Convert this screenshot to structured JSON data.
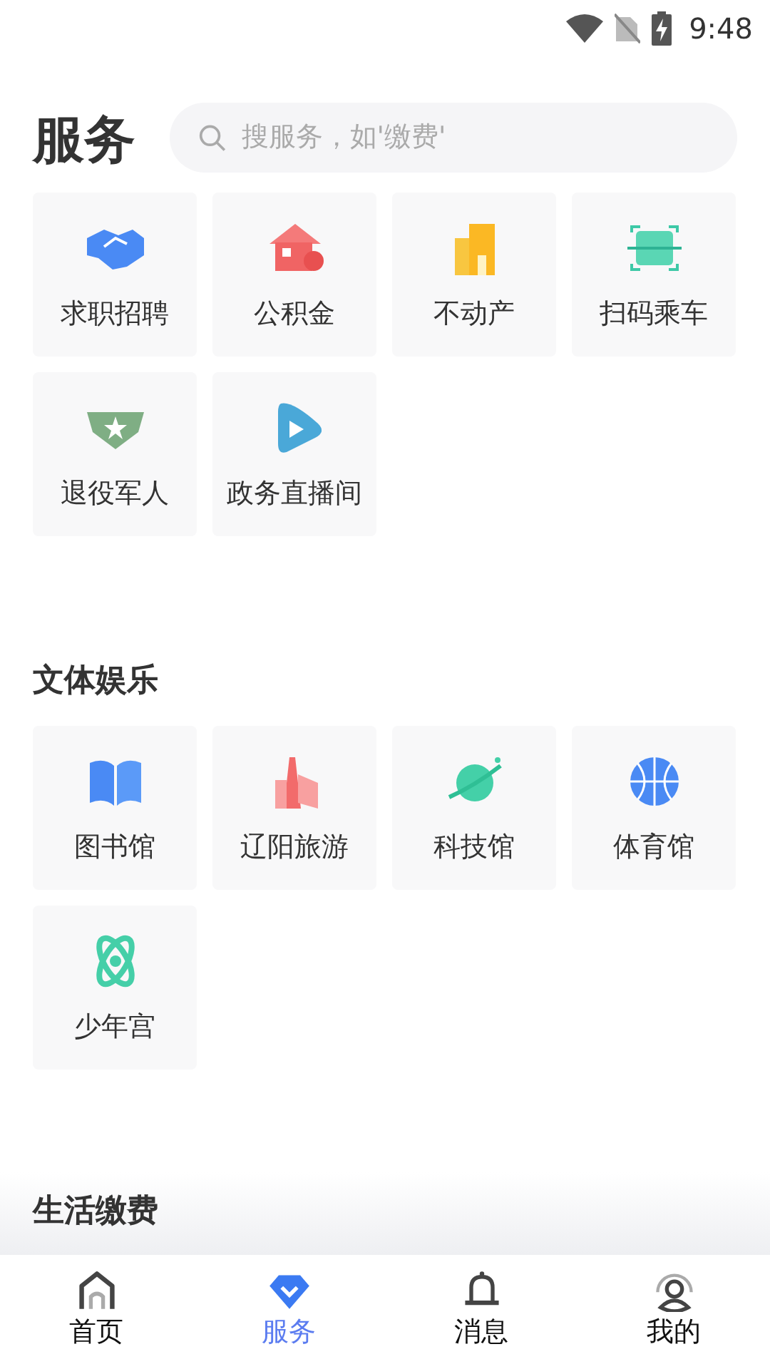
{
  "status_bar": {
    "time": "9:48"
  },
  "header": {
    "title": "服务",
    "search": {
      "placeholder": "搜服务，如'缴费'"
    }
  },
  "sections": [
    {
      "items": [
        {
          "label": "求职招聘"
        },
        {
          "label": "公积金"
        },
        {
          "label": "不动产"
        },
        {
          "label": "扫码乘车"
        },
        {
          "label": "退役军人"
        },
        {
          "label": "政务直播间"
        }
      ]
    },
    {
      "title": "文体娱乐",
      "items": [
        {
          "label": "图书馆"
        },
        {
          "label": "辽阳旅游"
        },
        {
          "label": "科技馆"
        },
        {
          "label": "体育馆"
        },
        {
          "label": "少年宫"
        }
      ]
    },
    {
      "title": "生活缴费"
    }
  ],
  "tab_bar": [
    {
      "label": "首页",
      "selected": false
    },
    {
      "label": "服务",
      "selected": true
    },
    {
      "label": "消息",
      "selected": false
    },
    {
      "label": "我的",
      "selected": false
    }
  ]
}
